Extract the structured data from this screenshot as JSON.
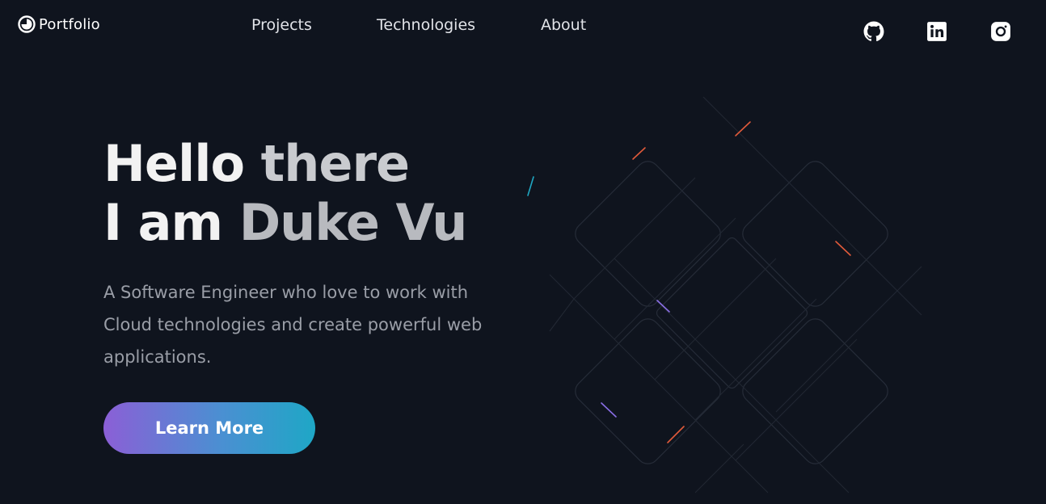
{
  "header": {
    "brand": {
      "label": "Portfolio",
      "icon": "half-circle-logo-icon"
    },
    "nav": [
      {
        "label": "Projects"
      },
      {
        "label": "Technologies"
      },
      {
        "label": "About"
      }
    ],
    "social": [
      {
        "icon": "github-icon"
      },
      {
        "icon": "linkedin-icon"
      },
      {
        "icon": "instagram-icon"
      }
    ]
  },
  "hero": {
    "line1_a": "Hello ",
    "line1_b": "there",
    "line2_a": "I am ",
    "line2_b": "Duke Vu",
    "description": "A Software Engineer who love to work with Cloud technologies and create powerful web applications.",
    "cta_label": "Learn More"
  },
  "colors": {
    "background": "#0f141e",
    "cta_gradient_start": "#8b5fd6",
    "cta_gradient_end": "#1ea7c6",
    "accent_orange": "#e05a3a",
    "accent_purple": "#8a6ee6",
    "accent_teal": "#1fa7c3"
  }
}
